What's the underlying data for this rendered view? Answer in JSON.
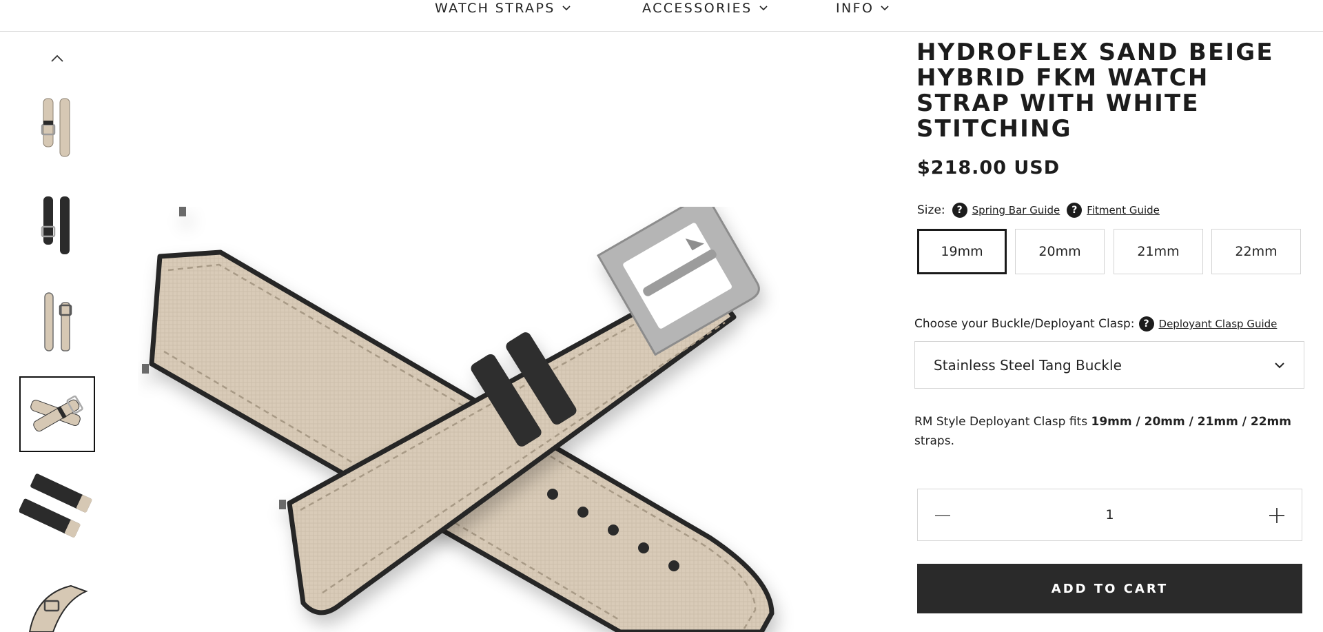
{
  "nav": {
    "items": [
      {
        "label": "WATCH STRAPS"
      },
      {
        "label": "ACCESSORIES"
      },
      {
        "label": "INFO"
      }
    ]
  },
  "product": {
    "title": "HYDROFLEX SAND BEIGE HYBRID FKM WATCH STRAP WITH WHITE STITCHING",
    "price": "$218.00 USD",
    "size_label": "Size:",
    "spring_bar_guide": "Spring Bar Guide",
    "fitment_guide": "Fitment Guide",
    "sizes": [
      "19mm",
      "20mm",
      "21mm",
      "22mm"
    ],
    "selected_size": "19mm",
    "clasp_label": "Choose your Buckle/Deployant Clasp:",
    "clasp_guide": "Deployant Clasp Guide",
    "clasp_selected": "Stainless Steel Tang Buckle",
    "fits_prefix": "RM Style Deployant Clasp fits ",
    "fits_sizes": "19mm / 20mm / 21mm / 22mm",
    "fits_suffix": " straps.",
    "quantity": "1",
    "add_to_cart": "ADD TO CART",
    "help_glyph": "?"
  },
  "colors": {
    "strap": "#d9cbb8",
    "edge": "#2b2b2b",
    "button": "#2a2a2a"
  }
}
